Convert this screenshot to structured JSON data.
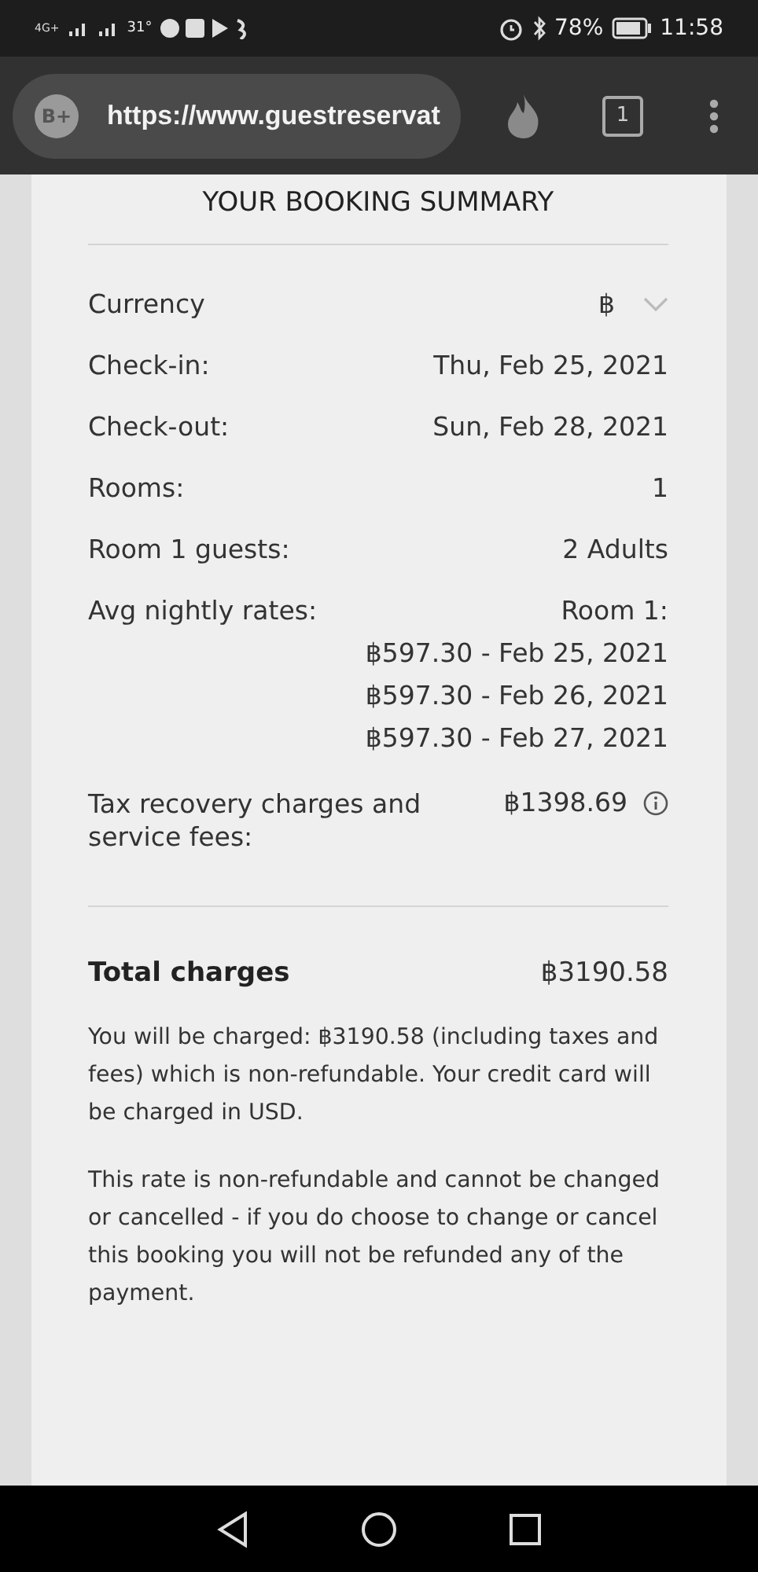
{
  "status_bar": {
    "network": "4G+",
    "temperature": "31°",
    "battery": "78%",
    "time": "11:58"
  },
  "browser": {
    "site_badge": "B+",
    "url": "https://www.guestreservat",
    "tab_count": "1"
  },
  "summary": {
    "title": "YOUR BOOKING SUMMARY",
    "currency": {
      "label": "Currency",
      "value": "฿"
    },
    "rows": [
      {
        "label": "Check-in:",
        "values": [
          "Thu, Feb 25, 2021"
        ]
      },
      {
        "label": "Check-out:",
        "values": [
          "Sun, Feb 28, 2021"
        ]
      },
      {
        "label": "Rooms:",
        "values": [
          "1"
        ]
      },
      {
        "label": "Room 1 guests:",
        "values": [
          "2 Adults"
        ]
      },
      {
        "label": "Avg nightly rates:",
        "values": [
          "Room 1:",
          "฿597.30 - Feb 25, 2021",
          "฿597.30 - Feb 26, 2021",
          "฿597.30 - Feb 27, 2021"
        ]
      }
    ],
    "tax": {
      "label": "Tax recovery charges and service fees:",
      "value": "฿1398.69"
    },
    "total": {
      "label": "Total charges",
      "value": "฿3190.58"
    },
    "notes": [
      "You will be charged: ฿3190.58 (including taxes and fees) which is non-refundable. Your credit card will be charged in USD.",
      "This rate is non-refundable and cannot be changed or cancelled - if you do choose to change or cancel this booking you will not be refunded any of the payment."
    ]
  }
}
